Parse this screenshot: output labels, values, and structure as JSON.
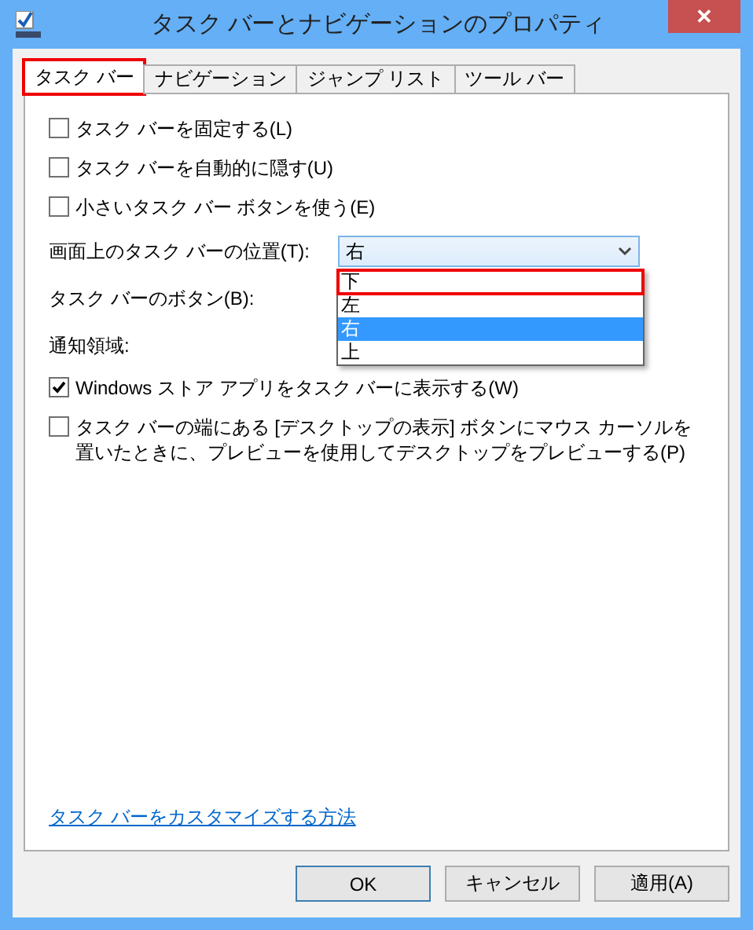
{
  "window": {
    "title": "タスク バーとナビゲーションのプロパティ",
    "close": "✕"
  },
  "tabs": [
    {
      "label": "タスク バー",
      "selected": true,
      "annotated": true
    },
    {
      "label": "ナビゲーション",
      "selected": false,
      "annotated": false
    },
    {
      "label": "ジャンプ リスト",
      "selected": false,
      "annotated": false
    },
    {
      "label": "ツール バー",
      "selected": false,
      "annotated": false
    }
  ],
  "options": [
    {
      "kind": "checkbox",
      "label": "タスク バーを固定する(L)",
      "checked": false
    },
    {
      "kind": "checkbox",
      "label": "タスク バーを自動的に隠す(U)",
      "checked": false
    },
    {
      "kind": "checkbox",
      "label": "小さいタスク バー ボタンを使う(E)",
      "checked": false
    },
    {
      "kind": "dropdown",
      "label": "画面上のタスク バーの位置(T):",
      "value": "右",
      "expanded": true,
      "choices": [
        {
          "label": "下",
          "selected": false,
          "annotated": true
        },
        {
          "label": "左",
          "selected": false,
          "annotated": false
        },
        {
          "label": "右",
          "selected": true,
          "annotated": false
        },
        {
          "label": "上",
          "selected": false,
          "annotated": false
        }
      ]
    },
    {
      "kind": "label",
      "label": "タスク バーのボタン(B):"
    },
    {
      "kind": "label",
      "label": "通知領域:"
    },
    {
      "kind": "checkbox",
      "label": "Windows ストア アプリをタスク バーに表示する(W)",
      "checked": true
    },
    {
      "kind": "checkbox",
      "label": "タスク バーの端にある [デスクトップの表示] ボタンにマウス カーソルを置いたときに、プレビューを使用してデスクトップをプレビューする(P)",
      "checked": false
    }
  ],
  "link": "タスク バーをカスタマイズする方法",
  "buttons": [
    {
      "label": "OK",
      "default": true
    },
    {
      "label": "キャンセル",
      "default": false
    },
    {
      "label": "適用(A)",
      "default": false
    }
  ]
}
